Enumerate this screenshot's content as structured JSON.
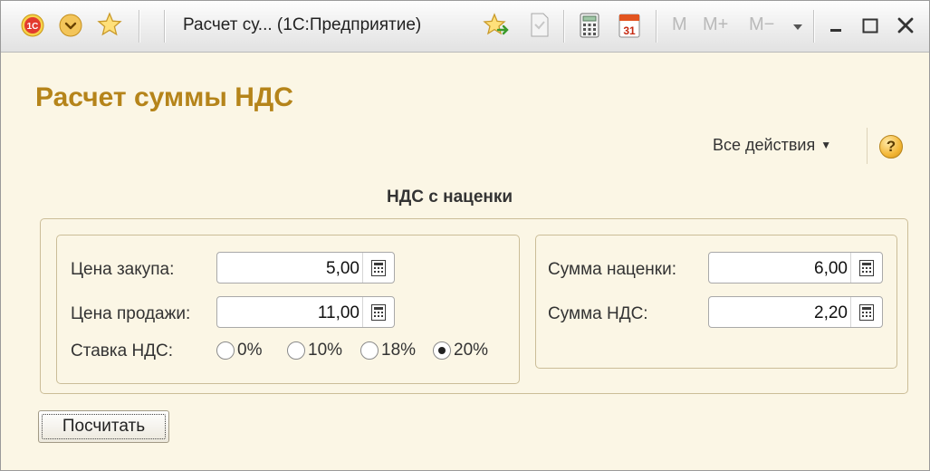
{
  "window": {
    "title": "Расчет су...  (1С:Предприятие)",
    "memory_labels": [
      "M",
      "M+",
      "M−"
    ],
    "colors": {
      "accent": "#b5841a",
      "form_background": "#fbf6e5",
      "border": "#cbbd98"
    }
  },
  "form": {
    "title": "Расчет суммы НДС",
    "all_actions_label": "Все действия",
    "help_label": "?",
    "group_title": "НДС с наценки",
    "purchase_price": {
      "label": "Цена закупа:",
      "value": "5,00"
    },
    "sale_price": {
      "label": "Цена продажи:",
      "value": "11,00"
    },
    "vat_rate": {
      "label": "Ставка НДС:",
      "options": [
        "0%",
        "10%",
        "18%",
        "20%"
      ],
      "selected": "20%"
    },
    "markup_sum": {
      "label": "Сумма наценки:",
      "value": "6,00"
    },
    "vat_sum": {
      "label": "Сумма НДС:",
      "value": "2,20"
    },
    "calculate_button": "Посчитать"
  }
}
